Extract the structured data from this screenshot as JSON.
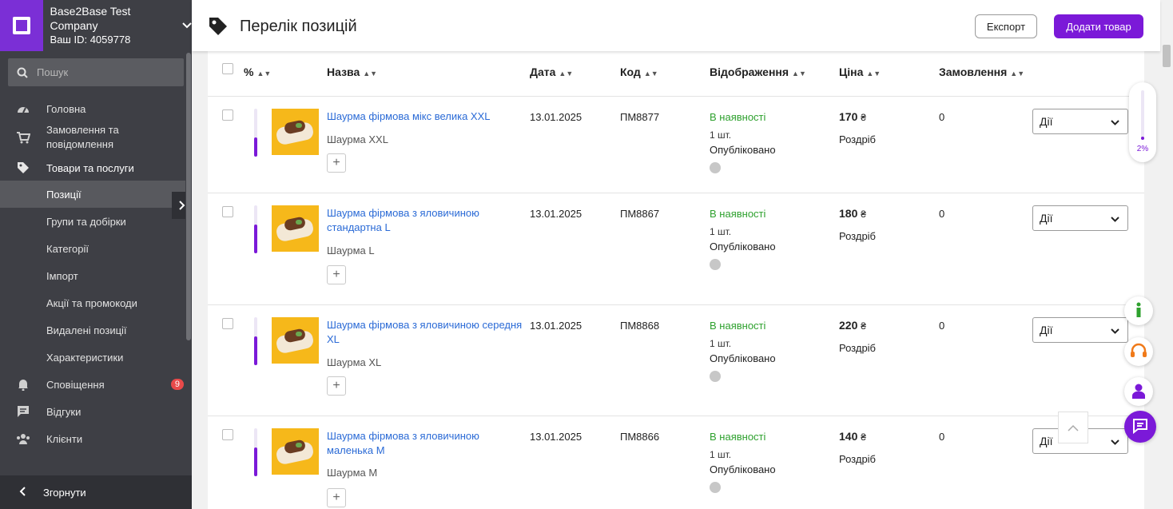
{
  "sidebar": {
    "company_name": "Base2Base Test Company",
    "company_id": "Ваш ID: 4059778",
    "search_placeholder": "Пошук",
    "items": [
      {
        "label": "Головна",
        "icon": "dashboard-icon"
      },
      {
        "label": "Замовлення та повідомлення",
        "icon": "cart-icon"
      },
      {
        "label": "Товари та послуги",
        "icon": "tag-icon"
      },
      {
        "label": "Позиції"
      },
      {
        "label": "Групи та добірки"
      },
      {
        "label": "Категорії"
      },
      {
        "label": "Імпорт"
      },
      {
        "label": "Акції та промокоди"
      },
      {
        "label": "Видалені позиції"
      },
      {
        "label": "Характеристики"
      },
      {
        "label": "Сповіщення",
        "icon": "bell-icon",
        "badge": "9"
      },
      {
        "label": "Відгуки",
        "icon": "comment-icon"
      },
      {
        "label": "Клієнти",
        "icon": "people-icon"
      }
    ],
    "collapse_label": "Згорнути"
  },
  "header": {
    "title": "Перелік позицій",
    "export_label": "Експорт",
    "add_label": "Додати товар"
  },
  "table": {
    "columns": [
      "%",
      "Назва",
      "Дата",
      "Код",
      "Відображення",
      "Ціна",
      "Замовлення"
    ],
    "rows": [
      {
        "name": "Шаурма фірмова мікс велика XXL",
        "sub": "Шаурма XXL",
        "date": "13.01.2025",
        "code": "ПМ8877",
        "status": "В наявності",
        "qty": "1 шт.",
        "published": "Опубліковано",
        "price": "170",
        "currency": "₴",
        "price_type": "Роздріб",
        "orders": "0",
        "action": "Дії",
        "fill": 0.4
      },
      {
        "name": "Шаурма фірмова з яловичиною стандартна L",
        "sub": "Шаурма L",
        "date": "13.01.2025",
        "code": "ПМ8867",
        "status": "В наявності",
        "qty": "1 шт.",
        "published": "Опубліковано",
        "price": "180",
        "currency": "₴",
        "price_type": "Роздріб",
        "orders": "0",
        "action": "Дії",
        "fill": 0.6
      },
      {
        "name": "Шаурма фірмова з яловичиною середня XL",
        "sub": "Шаурма XL",
        "date": "13.01.2025",
        "code": "ПМ8868",
        "status": "В наявності",
        "qty": "1 шт.",
        "published": "Опубліковано",
        "price": "220",
        "currency": "₴",
        "price_type": "Роздріб",
        "orders": "0",
        "action": "Дії",
        "fill": 0.6
      },
      {
        "name": "Шаурма фірмова з яловичиною маленька M",
        "sub": "Шаурма M",
        "date": "13.01.2025",
        "code": "ПМ8866",
        "status": "В наявності",
        "qty": "1 шт.",
        "published": "Опубліковано",
        "price": "140",
        "currency": "₴",
        "price_type": "Роздріб",
        "orders": "0",
        "action": "Дії",
        "fill": 0.6
      }
    ]
  },
  "widgets": {
    "completion_percent": "2%",
    "completion_fill": 0.02
  },
  "colors": {
    "accent": "#7b19d8",
    "sidebar_bg": "#3e3f45",
    "status_green": "#2ea12e",
    "link_blue": "#2a6ad6"
  }
}
